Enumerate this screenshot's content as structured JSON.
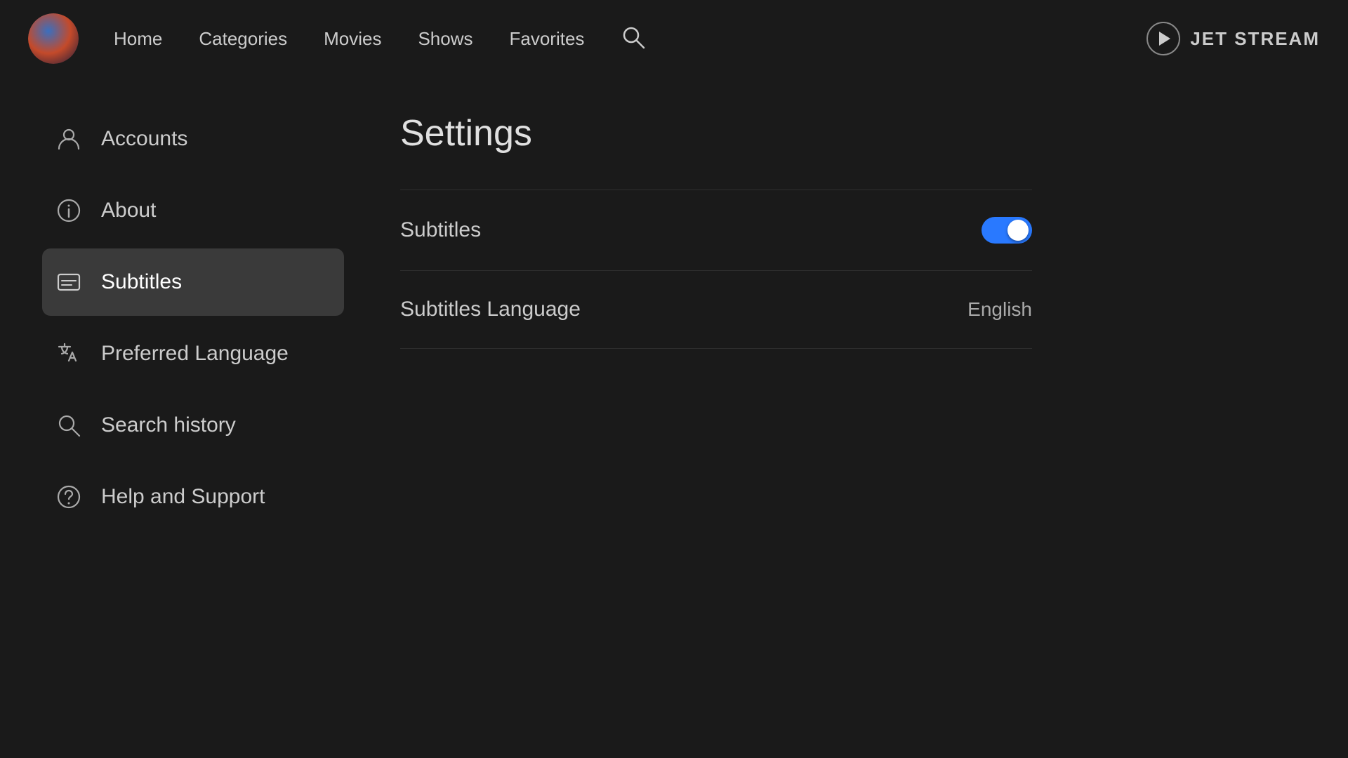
{
  "topnav": {
    "links": [
      {
        "label": "Home",
        "id": "home"
      },
      {
        "label": "Categories",
        "id": "categories"
      },
      {
        "label": "Movies",
        "id": "movies"
      },
      {
        "label": "Shows",
        "id": "shows"
      },
      {
        "label": "Favorites",
        "id": "favorites"
      }
    ],
    "brand": "JET STREAM"
  },
  "sidebar": {
    "items": [
      {
        "id": "accounts",
        "label": "Accounts",
        "icon": "person"
      },
      {
        "id": "about",
        "label": "About",
        "icon": "info"
      },
      {
        "id": "subtitles",
        "label": "Subtitles",
        "icon": "subtitles",
        "active": true
      },
      {
        "id": "preferred-language",
        "label": "Preferred Language",
        "icon": "translate"
      },
      {
        "id": "search-history",
        "label": "Search history",
        "icon": "search"
      },
      {
        "id": "help-and-support",
        "label": "Help and Support",
        "icon": "help"
      }
    ]
  },
  "content": {
    "title": "Settings",
    "rows": [
      {
        "id": "subtitles-toggle",
        "label": "Subtitles",
        "type": "toggle",
        "value": true
      },
      {
        "id": "subtitles-language",
        "label": "Subtitles Language",
        "type": "value",
        "value": "English"
      }
    ]
  }
}
